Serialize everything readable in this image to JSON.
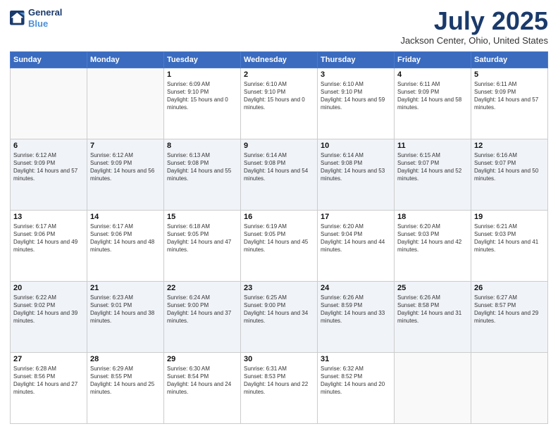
{
  "header": {
    "logo_line1": "General",
    "logo_line2": "Blue",
    "title": "July 2025",
    "location": "Jackson Center, Ohio, United States"
  },
  "weekdays": [
    "Sunday",
    "Monday",
    "Tuesday",
    "Wednesday",
    "Thursday",
    "Friday",
    "Saturday"
  ],
  "weeks": [
    [
      {
        "day": "",
        "info": ""
      },
      {
        "day": "",
        "info": ""
      },
      {
        "day": "1",
        "info": "Sunrise: 6:09 AM\nSunset: 9:10 PM\nDaylight: 15 hours and 0 minutes."
      },
      {
        "day": "2",
        "info": "Sunrise: 6:10 AM\nSunset: 9:10 PM\nDaylight: 15 hours and 0 minutes."
      },
      {
        "day": "3",
        "info": "Sunrise: 6:10 AM\nSunset: 9:10 PM\nDaylight: 14 hours and 59 minutes."
      },
      {
        "day": "4",
        "info": "Sunrise: 6:11 AM\nSunset: 9:09 PM\nDaylight: 14 hours and 58 minutes."
      },
      {
        "day": "5",
        "info": "Sunrise: 6:11 AM\nSunset: 9:09 PM\nDaylight: 14 hours and 57 minutes."
      }
    ],
    [
      {
        "day": "6",
        "info": "Sunrise: 6:12 AM\nSunset: 9:09 PM\nDaylight: 14 hours and 57 minutes."
      },
      {
        "day": "7",
        "info": "Sunrise: 6:12 AM\nSunset: 9:09 PM\nDaylight: 14 hours and 56 minutes."
      },
      {
        "day": "8",
        "info": "Sunrise: 6:13 AM\nSunset: 9:08 PM\nDaylight: 14 hours and 55 minutes."
      },
      {
        "day": "9",
        "info": "Sunrise: 6:14 AM\nSunset: 9:08 PM\nDaylight: 14 hours and 54 minutes."
      },
      {
        "day": "10",
        "info": "Sunrise: 6:14 AM\nSunset: 9:08 PM\nDaylight: 14 hours and 53 minutes."
      },
      {
        "day": "11",
        "info": "Sunrise: 6:15 AM\nSunset: 9:07 PM\nDaylight: 14 hours and 52 minutes."
      },
      {
        "day": "12",
        "info": "Sunrise: 6:16 AM\nSunset: 9:07 PM\nDaylight: 14 hours and 50 minutes."
      }
    ],
    [
      {
        "day": "13",
        "info": "Sunrise: 6:17 AM\nSunset: 9:06 PM\nDaylight: 14 hours and 49 minutes."
      },
      {
        "day": "14",
        "info": "Sunrise: 6:17 AM\nSunset: 9:06 PM\nDaylight: 14 hours and 48 minutes."
      },
      {
        "day": "15",
        "info": "Sunrise: 6:18 AM\nSunset: 9:05 PM\nDaylight: 14 hours and 47 minutes."
      },
      {
        "day": "16",
        "info": "Sunrise: 6:19 AM\nSunset: 9:05 PM\nDaylight: 14 hours and 45 minutes."
      },
      {
        "day": "17",
        "info": "Sunrise: 6:20 AM\nSunset: 9:04 PM\nDaylight: 14 hours and 44 minutes."
      },
      {
        "day": "18",
        "info": "Sunrise: 6:20 AM\nSunset: 9:03 PM\nDaylight: 14 hours and 42 minutes."
      },
      {
        "day": "19",
        "info": "Sunrise: 6:21 AM\nSunset: 9:03 PM\nDaylight: 14 hours and 41 minutes."
      }
    ],
    [
      {
        "day": "20",
        "info": "Sunrise: 6:22 AM\nSunset: 9:02 PM\nDaylight: 14 hours and 39 minutes."
      },
      {
        "day": "21",
        "info": "Sunrise: 6:23 AM\nSunset: 9:01 PM\nDaylight: 14 hours and 38 minutes."
      },
      {
        "day": "22",
        "info": "Sunrise: 6:24 AM\nSunset: 9:00 PM\nDaylight: 14 hours and 37 minutes."
      },
      {
        "day": "23",
        "info": "Sunrise: 6:25 AM\nSunset: 9:00 PM\nDaylight: 14 hours and 34 minutes."
      },
      {
        "day": "24",
        "info": "Sunrise: 6:26 AM\nSunset: 8:59 PM\nDaylight: 14 hours and 33 minutes."
      },
      {
        "day": "25",
        "info": "Sunrise: 6:26 AM\nSunset: 8:58 PM\nDaylight: 14 hours and 31 minutes."
      },
      {
        "day": "26",
        "info": "Sunrise: 6:27 AM\nSunset: 8:57 PM\nDaylight: 14 hours and 29 minutes."
      }
    ],
    [
      {
        "day": "27",
        "info": "Sunrise: 6:28 AM\nSunset: 8:56 PM\nDaylight: 14 hours and 27 minutes."
      },
      {
        "day": "28",
        "info": "Sunrise: 6:29 AM\nSunset: 8:55 PM\nDaylight: 14 hours and 25 minutes."
      },
      {
        "day": "29",
        "info": "Sunrise: 6:30 AM\nSunset: 8:54 PM\nDaylight: 14 hours and 24 minutes."
      },
      {
        "day": "30",
        "info": "Sunrise: 6:31 AM\nSunset: 8:53 PM\nDaylight: 14 hours and 22 minutes."
      },
      {
        "day": "31",
        "info": "Sunrise: 6:32 AM\nSunset: 8:52 PM\nDaylight: 14 hours and 20 minutes."
      },
      {
        "day": "",
        "info": ""
      },
      {
        "day": "",
        "info": ""
      }
    ]
  ]
}
